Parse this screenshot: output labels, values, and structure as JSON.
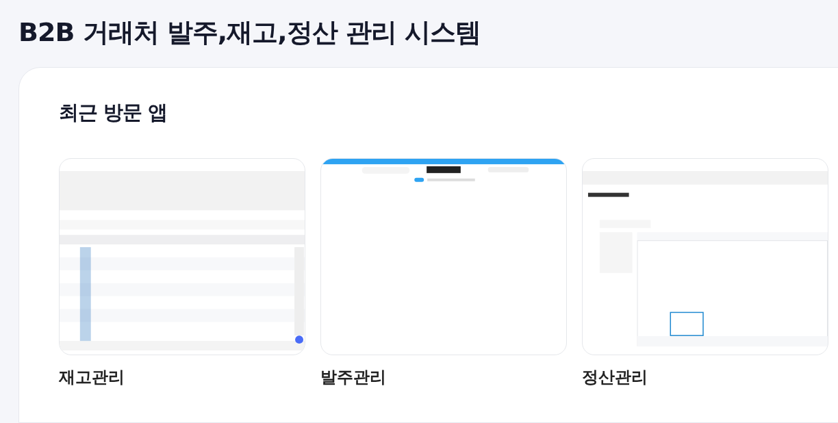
{
  "page_title": "B2B 거래처 발주,재고,정산 관리 시스템",
  "section": {
    "title": "최근 방문 앱",
    "apps": [
      {
        "label": "재고관리"
      },
      {
        "label": "발주관리"
      },
      {
        "label": "정산관리"
      }
    ]
  }
}
